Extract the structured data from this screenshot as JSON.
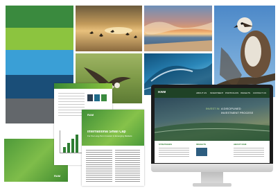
{
  "brand": {
    "logo": "RAM",
    "swatches": [
      "#2e7d32",
      "#8bc34a",
      "#3ea0d8",
      "#1b4f7a",
      "#666a6e"
    ]
  },
  "brochure": {
    "title": "International Small Cap",
    "subtitle": "For the Long-Term Investor in Emerging Markets"
  },
  "website": {
    "nav": [
      "ABOUT US",
      "INVESTMENT",
      "PORTFOLIOS",
      "INSIGHTS",
      "CONTACT US"
    ],
    "hero_kicker": "INVEST IN",
    "hero_line1": "A DISCIPLINED",
    "hero_line2": "INVESTMENT PROCESS",
    "columns": [
      "STRATEGIES",
      "INSIGHTS",
      "ABOUT RAM"
    ]
  }
}
